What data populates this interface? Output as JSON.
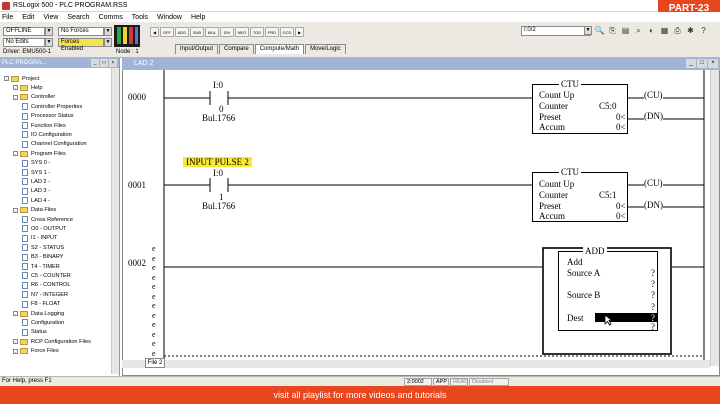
{
  "window": {
    "title": "RSLogix 500 - PLC PROGRAM.RSS",
    "part_badge": "PART-23"
  },
  "menu": [
    "File",
    "Edit",
    "View",
    "Search",
    "Comms",
    "Tools",
    "Window",
    "Help"
  ],
  "toolbar": {
    "mode": "OFFLINE",
    "no_forces": "No Forces",
    "no_edits": "No Edits",
    "forces_enabled": "Forces Enabled",
    "driver": "Driver: EMU500-1",
    "node": "Node : 1",
    "address": "I:0/2",
    "instr_buttons": [
      "OFF",
      "ADD",
      "SUB",
      "MUL",
      "DIV",
      "NEG",
      "TOD",
      "FRD",
      "GCD"
    ],
    "tabs": [
      "Input/Output",
      "Compare",
      "Compute/Math",
      "Move/Logic"
    ],
    "active_tab": "Compute/Math"
  },
  "project_panel": {
    "caption": "PLC PROGRA...",
    "items": [
      {
        "label": "Project",
        "kind": "folder",
        "indent": 0
      },
      {
        "label": "Help",
        "kind": "folder",
        "indent": 1
      },
      {
        "label": "Controller",
        "kind": "folder",
        "indent": 1
      },
      {
        "label": "Controller Properties",
        "kind": "doc",
        "indent": 2
      },
      {
        "label": "Processor Status",
        "kind": "doc",
        "indent": 2
      },
      {
        "label": "Function Files",
        "kind": "doc",
        "indent": 2
      },
      {
        "label": "IO Configuration",
        "kind": "doc",
        "indent": 2
      },
      {
        "label": "Channel Configuration",
        "kind": "doc",
        "indent": 2
      },
      {
        "label": "Program Files",
        "kind": "folder",
        "indent": 1
      },
      {
        "label": "SYS 0 -",
        "kind": "doc",
        "indent": 2
      },
      {
        "label": "SYS 1 -",
        "kind": "doc",
        "indent": 2
      },
      {
        "label": "LAD 2 -",
        "kind": "doc",
        "indent": 2
      },
      {
        "label": "LAD 3 -",
        "kind": "doc",
        "indent": 2
      },
      {
        "label": "LAD 4 -",
        "kind": "doc",
        "indent": 2
      },
      {
        "label": "Data Files",
        "kind": "folder",
        "indent": 1
      },
      {
        "label": "Cross Reference",
        "kind": "doc",
        "indent": 2
      },
      {
        "label": "O0 - OUTPUT",
        "kind": "doc",
        "indent": 2
      },
      {
        "label": "I1 - INPUT",
        "kind": "doc",
        "indent": 2
      },
      {
        "label": "S2 - STATUS",
        "kind": "doc",
        "indent": 2
      },
      {
        "label": "B3 - BINARY",
        "kind": "doc",
        "indent": 2
      },
      {
        "label": "T4 - TIMER",
        "kind": "doc",
        "indent": 2
      },
      {
        "label": "C5 - COUNTER",
        "kind": "doc",
        "indent": 2
      },
      {
        "label": "R6 - CONTROL",
        "kind": "doc",
        "indent": 2
      },
      {
        "label": "N7 - INTEGER",
        "kind": "doc",
        "indent": 2
      },
      {
        "label": "F8 - FLOAT",
        "kind": "doc",
        "indent": 2
      },
      {
        "label": "Data Logging",
        "kind": "folder",
        "indent": 1
      },
      {
        "label": "Configuration",
        "kind": "doc",
        "indent": 2
      },
      {
        "label": "Status",
        "kind": "doc",
        "indent": 2
      },
      {
        "label": "RCP Configuration Files",
        "kind": "folder",
        "indent": 1
      },
      {
        "label": "Force Files",
        "kind": "folder",
        "indent": 1
      }
    ]
  },
  "ladder": {
    "caption": "LAD 2",
    "file_tab": "File 2",
    "rungs": [
      {
        "number": "0000",
        "contact_addr": "I:0",
        "contact_bit": "0",
        "contact_desc": "Bul.1766",
        "block": {
          "name": "CTU",
          "title": "Count Up",
          "rows": [
            {
              "label": "Counter",
              "value": "C5:0"
            },
            {
              "label": "Preset",
              "value": "0<"
            },
            {
              "label": "Accum",
              "value": "0<"
            }
          ]
        },
        "coils": [
          "CU",
          "DN"
        ]
      },
      {
        "number": "0001",
        "comment": "INPUT PULSE 2",
        "contact_addr": "I:0",
        "contact_bit": "1",
        "contact_desc": "Bul.1766",
        "block": {
          "name": "CTU",
          "title": "Count Up",
          "rows": [
            {
              "label": "Counter",
              "value": "C5:1"
            },
            {
              "label": "Preset",
              "value": "0<"
            },
            {
              "label": "Accum",
              "value": "0<"
            }
          ]
        },
        "coils": [
          "CU",
          "DN"
        ]
      },
      {
        "number": "0002",
        "e_marker": "e",
        "block": {
          "name": "ADD",
          "title": "Add",
          "rows": [
            {
              "label": "Source A",
              "value": "?"
            },
            {
              "label": "",
              "value": "?"
            },
            {
              "label": "Source B",
              "value": "?"
            },
            {
              "label": "",
              "value": "?"
            },
            {
              "label": "Dest",
              "value": "?"
            },
            {
              "label": "",
              "value": "?"
            }
          ]
        }
      }
    ]
  },
  "status": {
    "help": "For Help, press F1",
    "address": "2:0002",
    "mode": "APP",
    "read": "READ",
    "disabled": "Disabled"
  },
  "banner": "visit all  playlist for more videos and tutorials"
}
